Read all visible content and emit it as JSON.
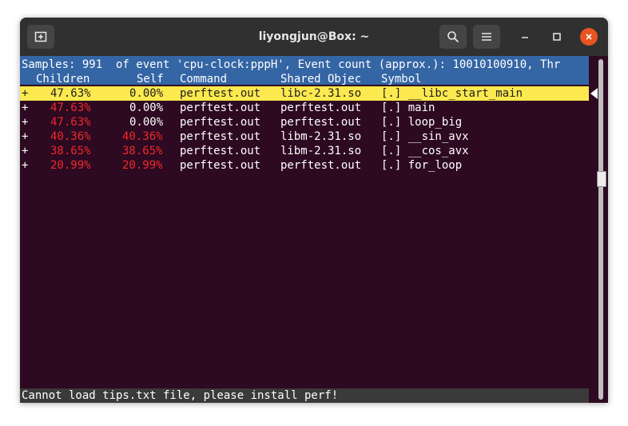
{
  "window": {
    "title": "liyongjun@Box: ~"
  },
  "colors": {
    "header_bg": "#3465a4",
    "highlight_bg": "#fce94f",
    "terminal_bg": "#2d0922",
    "percent_red": "#ef2929",
    "close_button": "#e95420"
  },
  "terminal": {
    "summary": "Samples: 991  of event 'cpu-clock:pppH', Event count (approx.): 10010100910, Thr",
    "columns": {
      "children": "Children",
      "self": "Self",
      "command": "Command",
      "shared": "Shared Objec",
      "symbol": "Symbol"
    },
    "rows": [
      {
        "plus": "+",
        "children": "47.63%",
        "self": "0.00%",
        "command": "perftest.out",
        "shared": "libc-2.31.so",
        "symbol": "[.] __libc_start_main"
      },
      {
        "plus": "+",
        "children": "47.63%",
        "self": "0.00%",
        "command": "perftest.out",
        "shared": "perftest.out",
        "symbol": "[.] main"
      },
      {
        "plus": "+",
        "children": "47.63%",
        "self": "0.00%",
        "command": "perftest.out",
        "shared": "perftest.out",
        "symbol": "[.] loop_big"
      },
      {
        "plus": "+",
        "children": "40.36%",
        "self": "40.36%",
        "command": "perftest.out",
        "shared": "libm-2.31.so",
        "symbol": "[.] __sin_avx"
      },
      {
        "plus": "+",
        "children": "38.65%",
        "self": "38.65%",
        "command": "perftest.out",
        "shared": "libm-2.31.so",
        "symbol": "[.] __cos_avx"
      },
      {
        "plus": "+",
        "children": "20.99%",
        "self": "20.99%",
        "command": "perftest.out",
        "shared": "perftest.out",
        "symbol": "[.] for_loop"
      }
    ],
    "status": "Cannot load tips.txt file, please install perf!"
  }
}
